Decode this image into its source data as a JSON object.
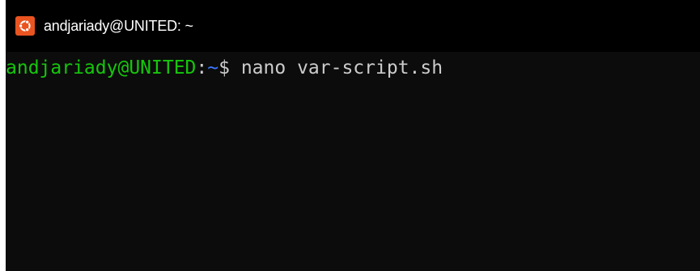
{
  "window": {
    "title": "andjariady@UNITED: ~",
    "app_icon": "ubuntu-logo-icon"
  },
  "terminal": {
    "prompt_user_host": "andjariady@UNITED",
    "prompt_separator": ":",
    "prompt_path": "~",
    "prompt_symbol": "$ ",
    "command": "nano var-script.sh"
  },
  "colors": {
    "titlebar_bg": "#000000",
    "terminal_bg": "#0c0c0c",
    "prompt_user": "#16c60c",
    "prompt_path": "#3b78ff",
    "text": "#cccccc",
    "icon_bg": "#e95420"
  }
}
